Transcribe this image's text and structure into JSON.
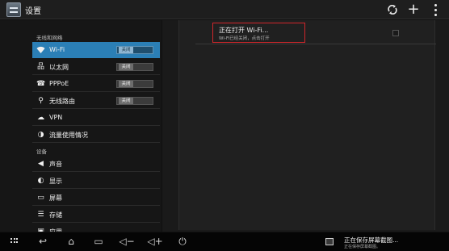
{
  "actionbar": {
    "title": "设置",
    "icons": {
      "sync": "sync-icon",
      "add": "add-icon",
      "more": "overflow-menu-icon"
    },
    "glyphs": {
      "add": "+"
    }
  },
  "sidebar": {
    "section_wireless": "无线和网络",
    "section_device": "设备",
    "items": [
      {
        "label": "Wi-Fi",
        "icon": "wifi-icon",
        "glyph": "ᯤ",
        "toggle": "关闭",
        "selected": true
      },
      {
        "label": "以太网",
        "icon": "ethernet-icon",
        "glyph": "品",
        "toggle": "关闭"
      },
      {
        "label": "PPPoE",
        "icon": "phone-icon",
        "glyph": "☎",
        "toggle": "关闭"
      },
      {
        "label": "无线路由",
        "icon": "hotspot-icon",
        "glyph": "⚲",
        "toggle": "关闭"
      },
      {
        "label": "VPN",
        "icon": "cloud-icon",
        "glyph": "☁"
      },
      {
        "label": "流量使用情况",
        "icon": "data-usage-icon",
        "glyph": "◑"
      },
      {
        "label": "声音",
        "icon": "speaker-icon",
        "glyph": "◀"
      },
      {
        "label": "显示",
        "icon": "display-icon",
        "glyph": "◐"
      },
      {
        "label": "屏幕",
        "icon": "screen-icon",
        "glyph": "▭"
      },
      {
        "label": "存储",
        "icon": "storage-icon",
        "glyph": "☰"
      },
      {
        "label": "应用",
        "icon": "apps-icon",
        "glyph": "▣"
      }
    ]
  },
  "wifi_panel": {
    "title": "正在打开 Wi-Fi...",
    "subtitle": "Wi-Fi已经关闭，点击打开",
    "highlight_color": "#d0262b"
  },
  "navbar": {
    "buttons": [
      "apps-icon",
      "back-icon",
      "home-icon",
      "recent-apps-icon",
      "volume-down-icon",
      "volume-up-icon",
      "power-icon"
    ],
    "glyphs": {
      "back": "↩",
      "home": "⌂",
      "recent": "▭",
      "voldown": "◁−",
      "volup": "◁+",
      "power": "⏻"
    }
  },
  "notification": {
    "title": "正在保存屏幕截图...",
    "subtitle": "正在保存屏幕截图。",
    "icon": "screenshot-icon"
  },
  "colors": {
    "accent": "#2b7fb6",
    "background": "#101010"
  }
}
